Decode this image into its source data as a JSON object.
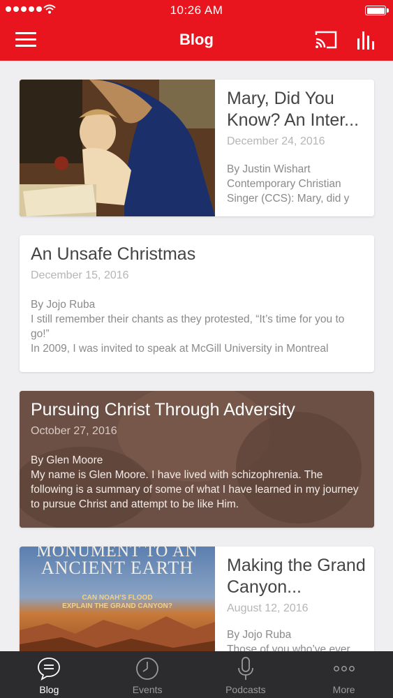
{
  "status_bar": {
    "time": "10:26 AM"
  },
  "header": {
    "title": "Blog"
  },
  "posts": [
    {
      "title": "Mary, Did You Know? An Inter...",
      "date": "December 24, 2016",
      "excerpt": "By Justin Wishart\nContemporary Christian\nSinger (CCS): Mary, did y"
    },
    {
      "title": "An Unsafe Christmas",
      "date": "December 15, 2016",
      "excerpt": "By Jojo Ruba\nI still remember their chants as they protested, “It’s time for you to go!”\nIn 2009, I was invited to speak at McGill University in Montreal"
    },
    {
      "title": "Pursuing Christ Through Adversity",
      "date": "October 27, 2016",
      "excerpt": "By Glen Moore\nMy name is Glen Moore. I have lived with schizophrenia. The following is a summary of some of what I have learned in my journey to pursue Christ and attempt to be like Him."
    },
    {
      "title": "Making the Grand Canyon...",
      "date": "August 12, 2016",
      "excerpt": "By Jojo Ruba\nThose of you who’ve ever",
      "image_text": [
        "MONUMENT TO AN",
        "ANCIENT EARTH",
        "CAN NOAH’S FLOOD",
        "EXPLAIN THE GRAND CANYON?"
      ]
    }
  ],
  "tabs": [
    {
      "label": "Blog",
      "icon": "chat-bubble-icon",
      "active": true
    },
    {
      "label": "Events",
      "icon": "clock-icon",
      "active": false
    },
    {
      "label": "Podcasts",
      "icon": "microphone-icon",
      "active": false
    },
    {
      "label": "More",
      "icon": "more-dots-icon",
      "active": false
    }
  ],
  "colors": {
    "brand_red": "#e8151f",
    "tabbar_bg": "#2c2c2e",
    "background": "#efeff1"
  }
}
